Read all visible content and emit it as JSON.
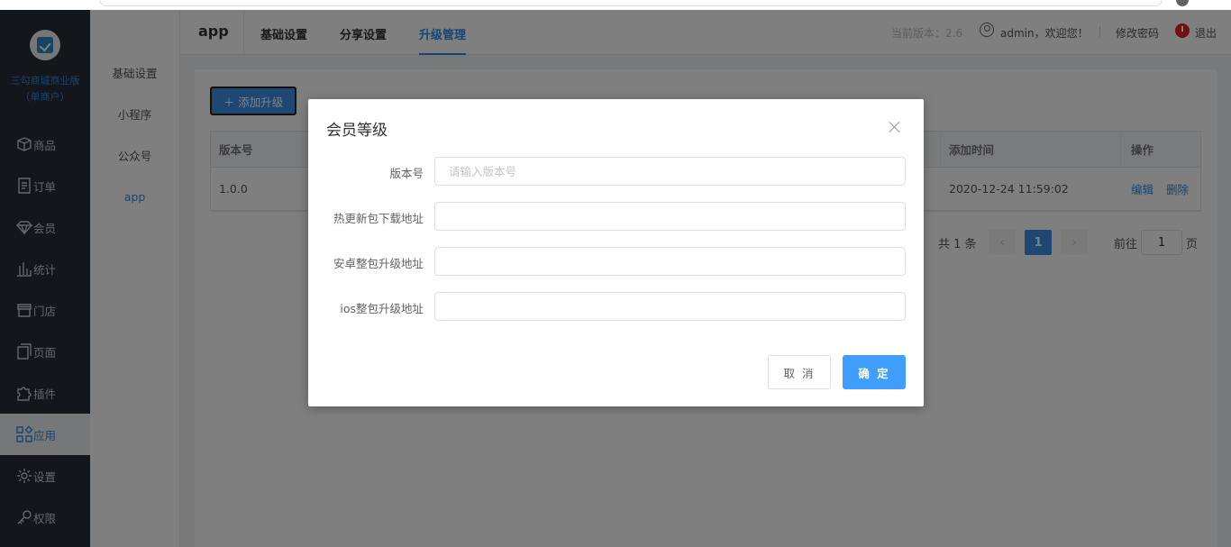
{
  "sidebar": {
    "brand_line1": "三勾商城商业版",
    "brand_line2": "（单商户）",
    "items": [
      {
        "label": "商品",
        "icon": "cube-icon"
      },
      {
        "label": "订单",
        "icon": "document-icon"
      },
      {
        "label": "会员",
        "icon": "diamond-icon"
      },
      {
        "label": "统计",
        "icon": "bar-chart-icon"
      },
      {
        "label": "门店",
        "icon": "store-icon"
      },
      {
        "label": "页面",
        "icon": "pages-icon"
      },
      {
        "label": "插件",
        "icon": "puzzle-icon"
      },
      {
        "label": "应用",
        "icon": "apps-icon",
        "active": true
      },
      {
        "label": "设置",
        "icon": "gear-icon"
      },
      {
        "label": "权限",
        "icon": "key-icon"
      }
    ]
  },
  "subnav": {
    "items": [
      "基础设置",
      "小程序",
      "公众号",
      "app"
    ],
    "active": "app"
  },
  "header": {
    "title": "app",
    "tabs": [
      "基础设置",
      "分享设置",
      "升级管理"
    ],
    "active_tab": "升级管理",
    "version_text": "当前版本：2.6",
    "welcome_text": "admin，欢迎您！",
    "change_password": "修改密码",
    "logout": "退出"
  },
  "content": {
    "add_button": "＋ 添加升级",
    "table": {
      "columns": [
        "版本号",
        "添加时间",
        "操作"
      ],
      "rows": [
        {
          "version": "1.0.0",
          "time": "2020-12-24 11:59:02",
          "actions": [
            "编辑",
            "删除"
          ]
        }
      ]
    },
    "pagination": {
      "total": "共 1 条",
      "prev": "‹",
      "current": "1",
      "next": "›",
      "goto_prefix": "前往",
      "goto_value": "1",
      "goto_suffix": "页"
    }
  },
  "modal": {
    "title": "会员等级",
    "fields": [
      {
        "label": "版本号",
        "value": "",
        "placeholder": "请输入版本号"
      },
      {
        "label": "热更新包下载地址",
        "value": "",
        "placeholder": ""
      },
      {
        "label": "安卓整包升级地址",
        "value": "",
        "placeholder": ""
      },
      {
        "label": "ios整包升级地址",
        "value": "",
        "placeholder": ""
      }
    ],
    "cancel": "取 消",
    "confirm": "确 定"
  },
  "colors": {
    "sidebar_bg": "#272c36",
    "accent": "#409eff",
    "brand": "#2e8be0",
    "danger": "#e02020"
  }
}
